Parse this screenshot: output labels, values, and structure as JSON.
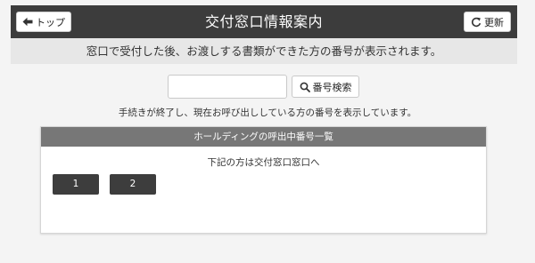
{
  "header": {
    "title": "交付窓口情報案内",
    "top_button_label": "トップ",
    "refresh_button_label": "更新",
    "top_button_icon": "arrow-left-icon",
    "refresh_button_icon": "refresh-icon",
    "bar_color": "#3c3c3c"
  },
  "notice": {
    "text": "窓口で受付した後、お渡しする書類ができた方の番号が表示されます。"
  },
  "search": {
    "value": "",
    "placeholder": "",
    "button_label": "番号検索",
    "button_icon": "search-icon"
  },
  "help_text": "手続きが終了し、現在お呼び出ししている方の番号を表示しています。",
  "panel": {
    "title": "ホールディングの呼出中番号一覧",
    "subtitle": "下記の方は交付窓口窓口へ",
    "header_color": "#777777",
    "numbers": [
      "1",
      "2"
    ]
  }
}
